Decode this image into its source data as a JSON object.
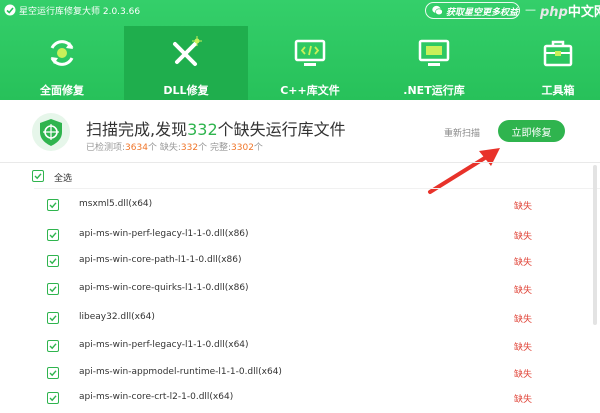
{
  "app": {
    "title": "星空运行库修复大师 2.0.3.66"
  },
  "titlebar": {
    "promo": "获取星空更多权益",
    "minimize": "—",
    "watermark_php": "php",
    "watermark_cn": "中文网"
  },
  "tabs": [
    {
      "label": "全面修复",
      "icon": "refresh-shield-icon"
    },
    {
      "label": "DLL修复",
      "icon": "wrench-screwdriver-icon"
    },
    {
      "label": "C++库文件",
      "icon": "code-monitor-icon"
    },
    {
      "label": ".NET运行库",
      "icon": "net-monitor-icon"
    },
    {
      "label": "工具箱",
      "icon": "toolbox-icon"
    }
  ],
  "summary": {
    "title_prefix": "扫描完成,发现",
    "title_count": "332",
    "title_suffix": "个缺失运行库文件",
    "checked_label": "已检测项:",
    "checked_value": "3634",
    "checked_unit": "个",
    "missing_label": "缺失:",
    "missing_value": "332",
    "missing_unit": "个",
    "complete_label": "完整:",
    "complete_value": "3302",
    "complete_unit": "个",
    "rescan": "重新扫描",
    "fix_now": "立即修复"
  },
  "list": {
    "select_all": "全选",
    "rows": [
      {
        "name": "msxml5.dll(x64)",
        "status": "缺失"
      },
      {
        "name": "api-ms-win-perf-legacy-l1-1-0.dll(x86)",
        "status": "缺失"
      },
      {
        "name": "api-ms-win-core-path-l1-1-0.dll(x86)",
        "status": "缺失"
      },
      {
        "name": "api-ms-win-core-quirks-l1-1-0.dll(x86)",
        "status": "缺失"
      },
      {
        "name": "libeay32.dll(x64)",
        "status": "缺失"
      },
      {
        "name": "api-ms-win-perf-legacy-l1-1-0.dll(x64)",
        "status": "缺失"
      },
      {
        "name": "api-ms-win-appmodel-runtime-l1-1-0.dll(x64)",
        "status": "缺失"
      },
      {
        "name": "api-ms-win-core-crt-l2-1-0.dll(x64)",
        "status": "缺失"
      }
    ]
  },
  "colors": {
    "brand_green": "#2fb44e",
    "header_green": "#27c15a",
    "missing_red": "#e0463a",
    "count_orange": "#f0762a"
  }
}
